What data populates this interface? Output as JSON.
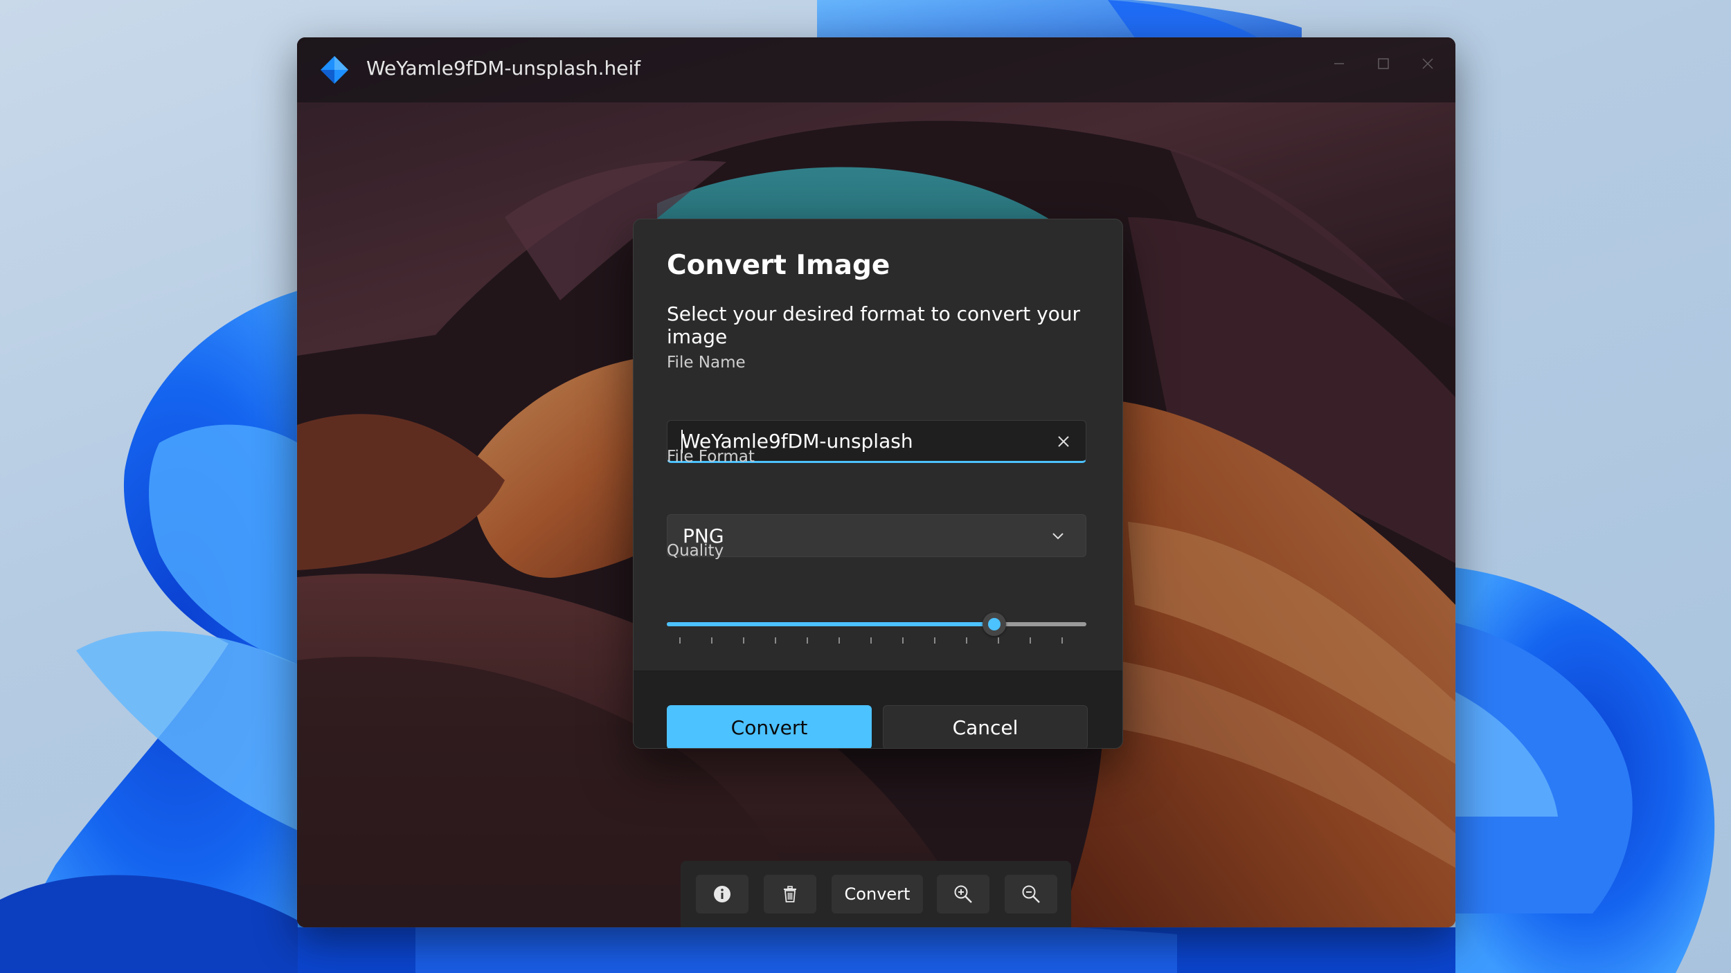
{
  "window": {
    "title": "WeYamle9fDM-unsplash.heif"
  },
  "dialog": {
    "title": "Convert Image",
    "subtitle": "Select your desired format to convert your image",
    "file_name_label": "File Name",
    "file_name_value": "WeYamle9fDM-unsplash",
    "file_format_label": "File Format",
    "file_format_value": "PNG",
    "quality_label": "Quality",
    "quality_fraction": 0.78,
    "quality_ticks": 13,
    "convert_label": "Convert",
    "cancel_label": "Cancel"
  },
  "toolbar": {
    "info_icon": "info-icon",
    "delete_icon": "trash-icon",
    "convert_label": "Convert",
    "zoom_in_icon": "zoom-in-icon",
    "zoom_out_icon": "zoom-out-icon"
  },
  "colors": {
    "accent": "#4cc2ff",
    "dialog_bg": "#2b2b2b",
    "footer_bg": "#202020",
    "logo": "#1e90ff"
  }
}
